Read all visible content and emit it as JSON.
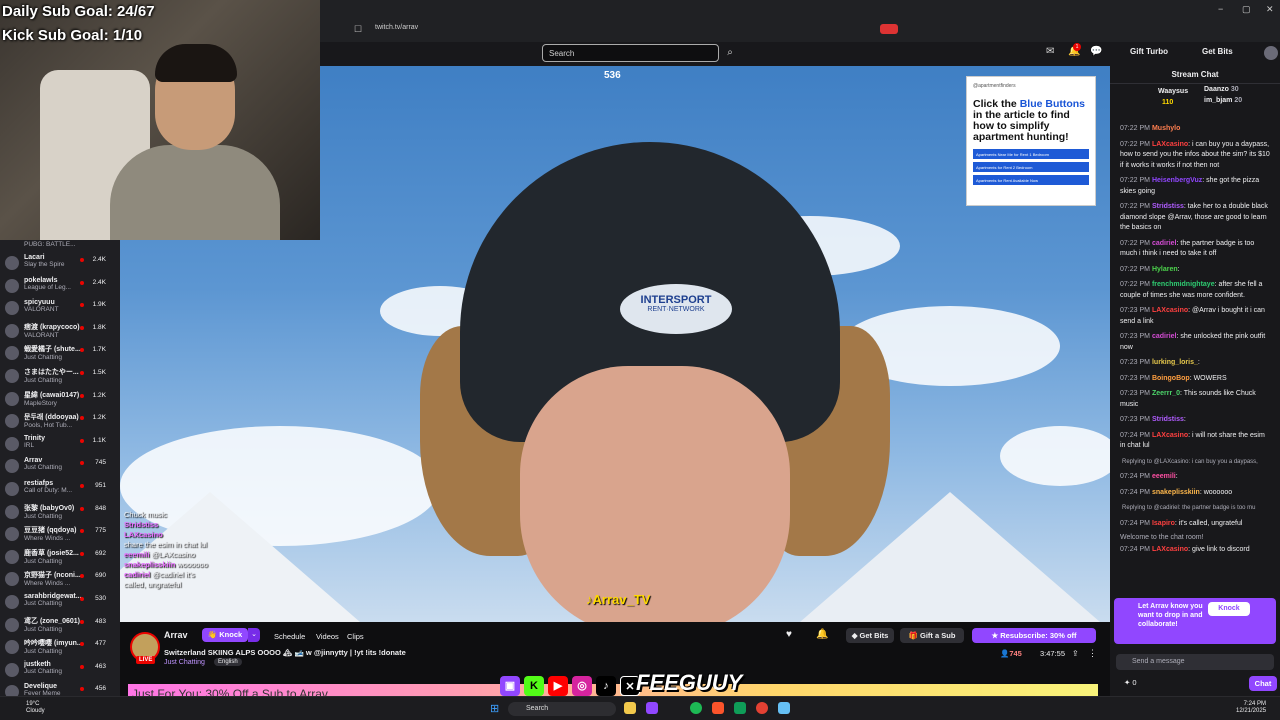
{
  "overlay": {
    "daily_goal": "Daily Sub Goal: 24/67",
    "kick_goal": "Kick Sub Goal: 1/10",
    "viewer_number": "536",
    "name_tag": "Arrav_TV",
    "logo_text": "FEEGUUY"
  },
  "browser": {
    "url": "twitch.tv/arrav",
    "window_controls": [
      "−",
      "▢",
      "✕"
    ]
  },
  "topnav": {
    "search_placeholder": "Search",
    "gift_turbo": "Gift Turbo",
    "get_bits": "Get Bits",
    "notif_count": "1"
  },
  "sidebar": {
    "header": "PUBG: BATTLE...",
    "channels": [
      {
        "name": "Lacari",
        "game": "Slay the Spire",
        "viewers": "2.4K"
      },
      {
        "name": "pokelawls",
        "game": "League of Leg...",
        "viewers": "2.4K"
      },
      {
        "name": "spicyuuu",
        "game": "VALORANT",
        "viewers": "1.9K"
      },
      {
        "name": "痞渡 (krapycoco)",
        "game": "VALORANT",
        "viewers": "1.8K"
      },
      {
        "name": "蝦愛橘子 (shute...",
        "game": "Just Chatting",
        "viewers": "1.7K"
      },
      {
        "name": "さまはたたやー...",
        "game": "Just Chatting",
        "viewers": "1.5K"
      },
      {
        "name": "星緯 (cawai0147)",
        "game": "MapleStory",
        "viewers": "1.2K"
      },
      {
        "name": "문두래 (ddooyaa)",
        "game": "Pools, Hot Tub...",
        "viewers": "1.2K"
      },
      {
        "name": "Trinity",
        "game": "IRL",
        "viewers": "1.1K"
      },
      {
        "name": "Arrav",
        "game": "Just Chatting",
        "viewers": "745"
      },
      {
        "name": "restiafps",
        "game": "Call of Duty: M...",
        "viewers": "951"
      },
      {
        "name": "张黎 (babyOv0)",
        "game": "Just Chatting",
        "viewers": "848"
      },
      {
        "name": "豆豆猪 (qqdoya)",
        "game": "Where Winds ...",
        "viewers": "775"
      },
      {
        "name": "鹿香草 (josie52...",
        "game": "Just Chatting",
        "viewers": "692"
      },
      {
        "name": "京野猫子 (nconi...",
        "game": "Where Winds ...",
        "viewers": "690"
      },
      {
        "name": "sarahbridgewat...",
        "game": "Just Chatting",
        "viewers": "530"
      },
      {
        "name": "鸢乙 (zone_0601)",
        "game": "Just Chatting",
        "viewers": "483"
      },
      {
        "name": "吟吟嘤嘤 (imyun...",
        "game": "Just Chatting",
        "viewers": "477"
      },
      {
        "name": "justketh",
        "game": "Just Chatting",
        "viewers": "463"
      },
      {
        "name": "Develique",
        "game": "Fever Meme",
        "viewers": "456"
      }
    ]
  },
  "ad": {
    "brand": "@apartmentfinders",
    "headline_pre": "Click the ",
    "headline_blue": "Blue Buttons",
    "headline_post": " in the article to find how to simplify apartment hunting!",
    "links": [
      "Apartments Near Me for Rent 1 Bedroom",
      "Apartments for Rent 2 Bedroom",
      "Apartments for Rent Available Now"
    ]
  },
  "video_chat": [
    {
      "user": "",
      "text": "Chuck music"
    },
    {
      "user": "Stridstiss",
      "text": ""
    },
    {
      "user": "LAXcasino",
      "text": ""
    },
    {
      "user": "",
      "text": "share the esim in chat lul"
    },
    {
      "user": "eeemili",
      "text": "@LAXcasino"
    },
    {
      "user": "snakeplisskiin",
      "text": "woooooo"
    },
    {
      "user": "cadiriel",
      "text": "@cadiriel it's"
    },
    {
      "user": "",
      "text": "called, ungrateful"
    }
  ],
  "stream": {
    "streamer": "Arrav",
    "knock": "Knock",
    "tabs": [
      "Schedule",
      "Videos",
      "Clips"
    ],
    "title": "Switzerland SKIING ALPS OOOO 🏔 🎿 w @jinnytty | !yt !its !donate",
    "category": "Just Chatting",
    "language": "English",
    "live": "LIVE",
    "get_bits": "Get Bits",
    "gift_sub": "Gift a Sub",
    "resubscribe": "Resubscribe: 30% off",
    "viewers": "745",
    "uptime": "3:47:55",
    "promo_banner": "Just For You: 30% Off a Sub to Arrav"
  },
  "chat": {
    "header": "Stream Chat",
    "gifters": [
      {
        "name": "Waaysus",
        "count": "110"
      },
      {
        "name": "Daanzo",
        "count": "30"
      },
      {
        "name": "im_bjam",
        "count": "20"
      }
    ],
    "messages": [
      {
        "time": "07:22 PM",
        "user": "Mushylo",
        "color": "#ff7f50",
        "text": ""
      },
      {
        "time": "07:22 PM",
        "user": "LAXcasino",
        "color": "#ff4040",
        "text": ": i can buy you a daypass, how to send you the infos about the sim? its $10 if it works it works if not then not"
      },
      {
        "time": "07:22 PM",
        "user": "HeisenbergVuz",
        "color": "#9147ff",
        "text": ": she got the pizza skies going"
      },
      {
        "time": "07:22 PM",
        "user": "Stridstiss",
        "color": "#b05cff",
        "text": ": take her to a double black diamond slope @Arrav, those are good to learn the basics on"
      },
      {
        "time": "07:22 PM",
        "user": "cadiriel",
        "color": "#d44cd4",
        "text": ": the partner badge is too much i think i need to take it off"
      },
      {
        "time": "07:22 PM",
        "user": "Hylaren",
        "color": "#4cd44c",
        "text": ":"
      },
      {
        "time": "07:22 PM",
        "user": "frenchmidnightaye",
        "color": "#2ecc71",
        "text": ": after she fell a couple of times she was more confident."
      },
      {
        "time": "07:23 PM",
        "user": "LAXcasino",
        "color": "#ff4040",
        "text": ": @Arrav i bought it i can send a link"
      },
      {
        "time": "07:23 PM",
        "user": "cadiriel",
        "color": "#d44cd4",
        "text": ": she unlocked the pink outfit now"
      },
      {
        "time": "07:23 PM",
        "user": "lurking_loris_",
        "color": "#e6c84c",
        "text": ":"
      },
      {
        "time": "07:23 PM",
        "user": "BoingoBop",
        "color": "#ff9f40",
        "text": ": WOWERS"
      },
      {
        "time": "07:23 PM",
        "user": "Zeerrr_0",
        "color": "#4cd46a",
        "text": ": This sounds like Chuck music"
      },
      {
        "time": "07:23 PM",
        "user": "Stridstiss",
        "color": "#b05cff",
        "text": ":"
      },
      {
        "time": "07:24 PM",
        "user": "LAXcasino",
        "color": "#ff4040",
        "text": ": i will not share the esim in chat lul"
      },
      {
        "time": "",
        "user": "",
        "color": "#adadb8",
        "text": "Replying to @LAXcasino: i can buy you a daypass,",
        "reply": true
      },
      {
        "time": "07:24 PM",
        "user": "eeemili",
        "color": "#ff4fa3",
        "text": ":"
      },
      {
        "time": "07:24 PM",
        "user": "snakeplisskiin",
        "color": "#ffb84c",
        "text": ": woooooo"
      },
      {
        "time": "",
        "user": "",
        "color": "#adadb8",
        "text": "Replying to @cadiriel: the partner badge is too mu",
        "reply": true
      },
      {
        "time": "07:24 PM",
        "user": "Isapiro",
        "color": "#ff4040",
        "text": ": it's called, ungrateful"
      }
    ],
    "welcome": "Welcome to the chat room!",
    "last": {
      "time": "07:24 PM",
      "user": "LAXcasino",
      "color": "#ff4040",
      "text": ": give link to discord"
    },
    "promo": "Let Arrav know you want to drop in and collaborate!",
    "promo_knock": "Knock",
    "input_placeholder": "Send a message",
    "points": "0",
    "chat_button": "Chat"
  },
  "taskbar": {
    "temp": "19°C",
    "weather": "Cloudy",
    "search": "Search",
    "time": "7:24 PM",
    "date": "12/21/2025"
  }
}
